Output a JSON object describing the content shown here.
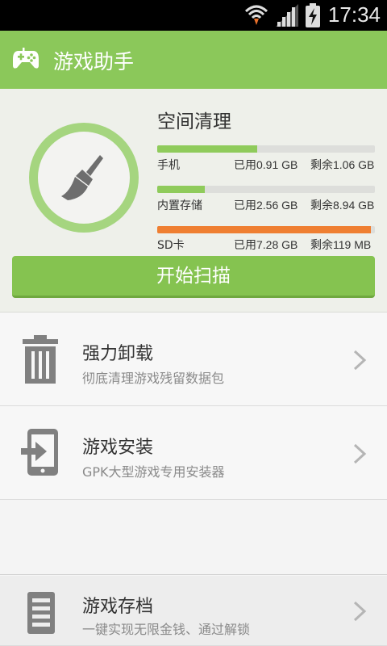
{
  "status_bar": {
    "time": "17:34"
  },
  "header": {
    "title": "游戏助手",
    "icon": "gamepad-icon"
  },
  "storage": {
    "title": "空间清理",
    "icon": "broom-icon",
    "rows": [
      {
        "label": "手机",
        "used": "已用0.91 GB",
        "free": "剩余1.06 GB",
        "used_fraction": 0.46,
        "color": "#8fcb5b"
      },
      {
        "label": "内置存储",
        "used": "已用2.56 GB",
        "free": "剩余8.94 GB",
        "used_fraction": 0.22,
        "color": "#8fcb5b"
      },
      {
        "label": "SD卡",
        "used": "已用7.28 GB",
        "free": "剩余119 MB",
        "used_fraction": 0.98,
        "color": "#ef7f32"
      }
    ],
    "scan_button": "开始扫描"
  },
  "list": [
    {
      "name": "强力卸载",
      "desc": "彻底清理游戏残留数据包",
      "icon": "trash-icon"
    },
    {
      "name": "游戏安装",
      "desc": "GPK大型游戏专用安装器",
      "icon": "install-icon"
    },
    {
      "name": "游戏存档",
      "desc": "一键实现无限金钱、通过解锁",
      "icon": "save-file-icon"
    }
  ],
  "colors": {
    "accent": "#8bc85a",
    "warning": "#ef7f32"
  }
}
